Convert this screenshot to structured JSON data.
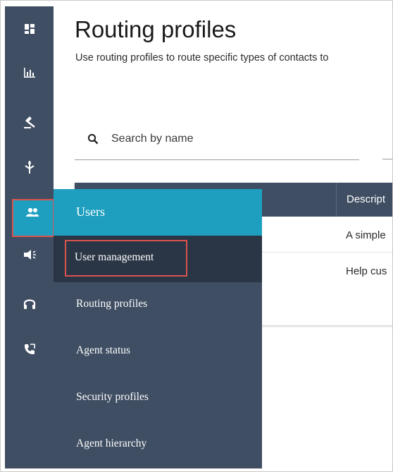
{
  "page": {
    "title": "Routing profiles",
    "subtitle": "Use routing profiles to route specific types of contacts to"
  },
  "search": {
    "placeholder": "Search by name"
  },
  "table": {
    "columns": [
      "Descript"
    ],
    "rows": [
      {
        "description": "A simple"
      },
      {
        "description": "Help cus"
      }
    ]
  },
  "rail": {
    "icons": [
      "dashboard-icon",
      "metrics-icon",
      "routing-icon",
      "channels-icon",
      "users-icon",
      "campaigns-icon",
      "headset-icon",
      "phone-icon"
    ],
    "active": "users-icon"
  },
  "flyout": {
    "title": "Users",
    "items": [
      {
        "label": "User management",
        "selected": true
      },
      {
        "label": "Routing profiles"
      },
      {
        "label": "Agent status"
      },
      {
        "label": "Security profiles"
      },
      {
        "label": "Agent hierarchy"
      }
    ]
  },
  "colors": {
    "rail": "#3f4e63",
    "accent": "#1f9fbf",
    "highlight": "#d9534f",
    "selected_item": "#2a3545"
  }
}
